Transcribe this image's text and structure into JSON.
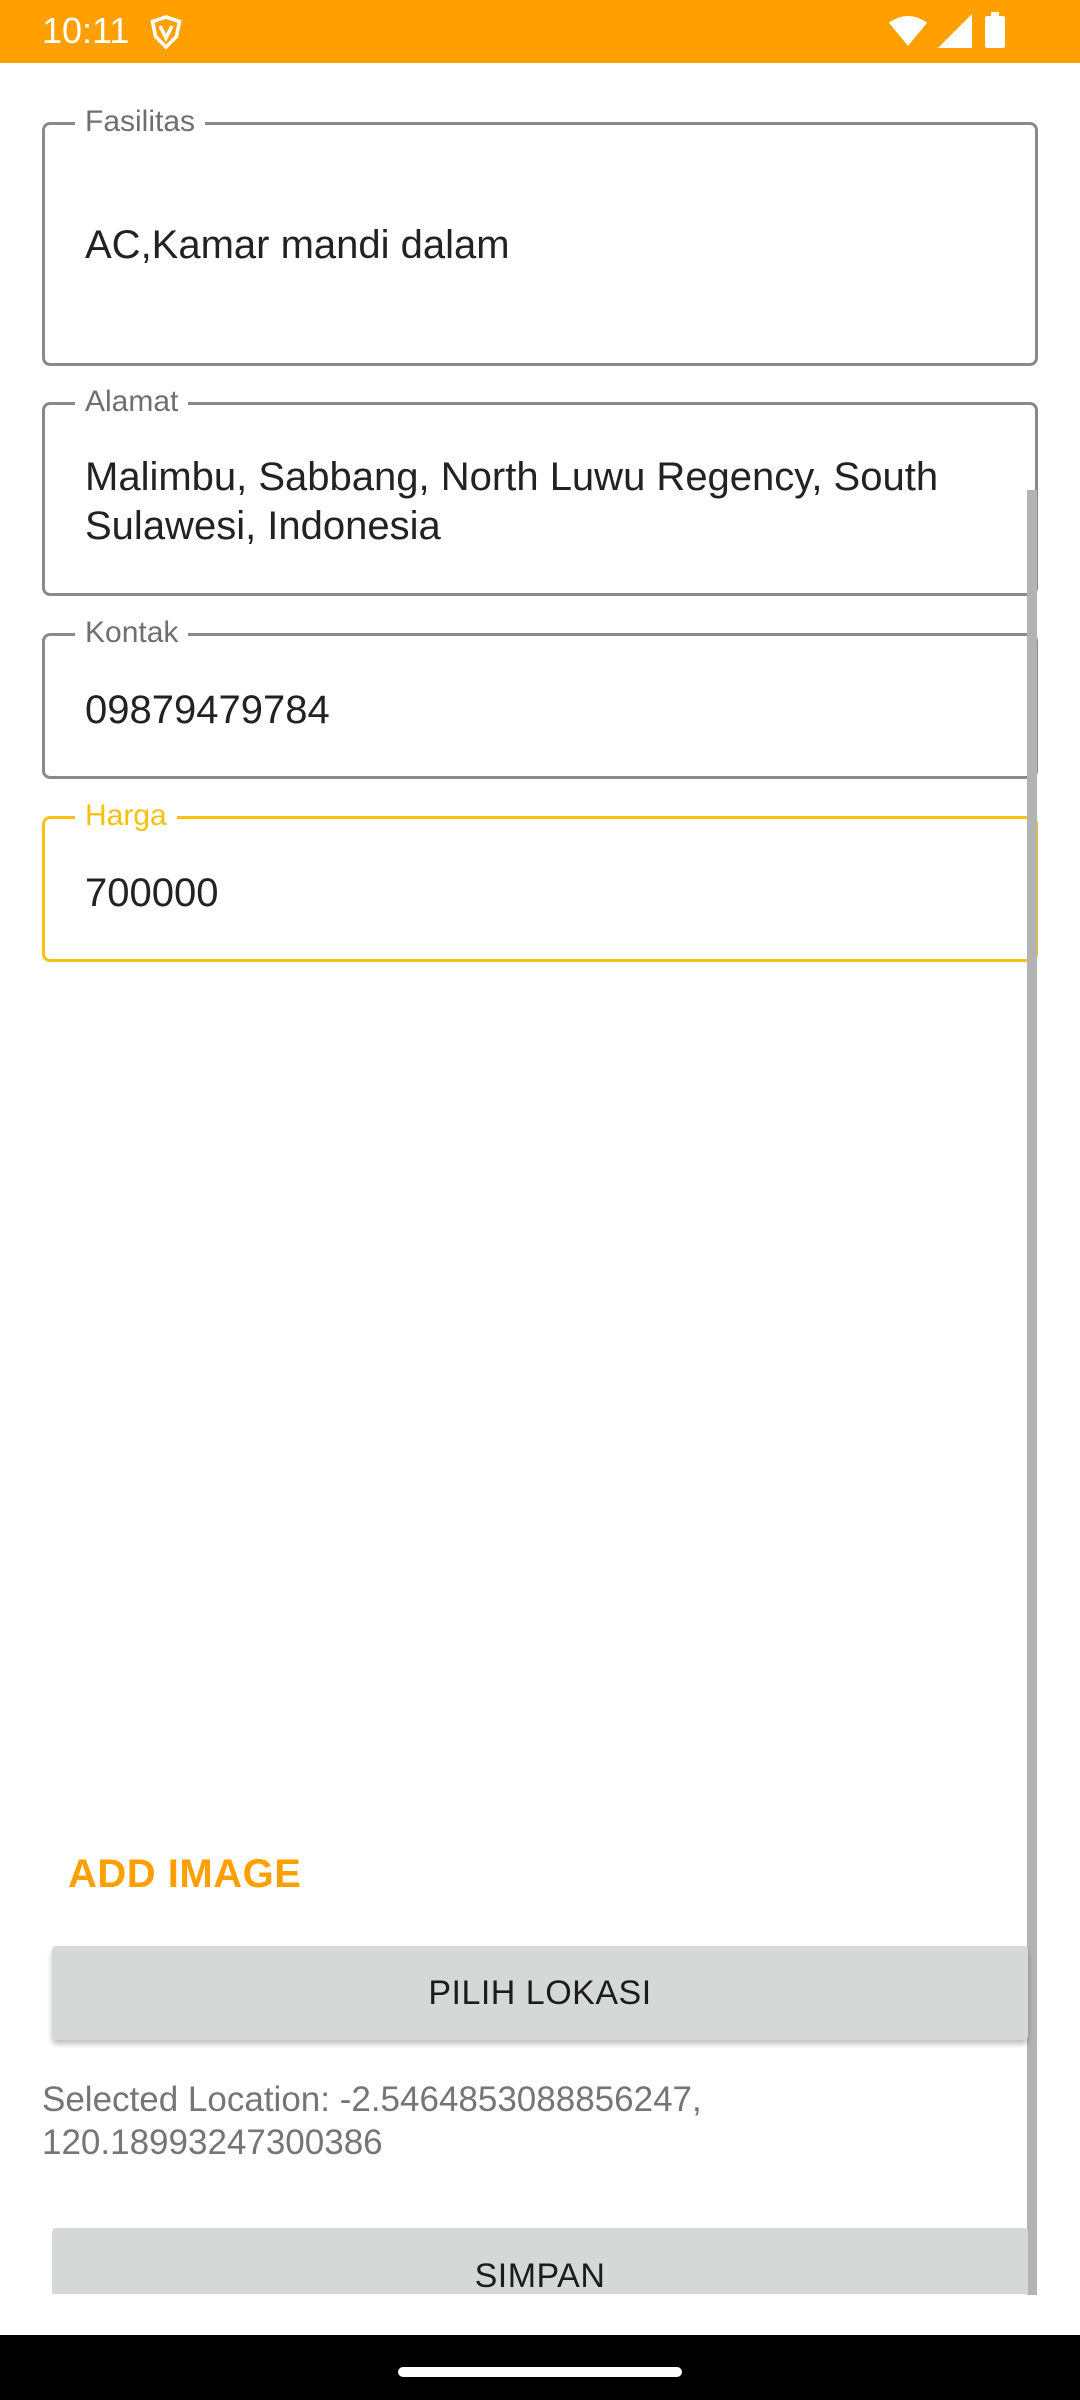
{
  "status_bar": {
    "time": "10:11",
    "background": "#FFA000",
    "icons": [
      "vpn-icon",
      "wifi-icon",
      "signal-icon",
      "battery-icon"
    ]
  },
  "form": {
    "facilities": {
      "label": "Fasilitas",
      "value": "AC,Kamar mandi dalam"
    },
    "address": {
      "label": "Alamat",
      "value": "Malimbu, Sabbang, North Luwu Regency, South Sulawesi, Indonesia"
    },
    "contact": {
      "label": "Kontak",
      "value": "09879479784"
    },
    "price": {
      "label": "Harga",
      "value": "700000",
      "focused": true,
      "focus_color": "#F9C00F"
    }
  },
  "actions": {
    "add_image": "ADD IMAGE",
    "choose_location": "PILIH LOKASI",
    "selected_location": "Selected Location: -2.5464853088856247, 120.18993247300386",
    "save": "SIMPAN"
  },
  "colors": {
    "accent": "#FFA000",
    "button_bg": "#D6D7D7"
  }
}
